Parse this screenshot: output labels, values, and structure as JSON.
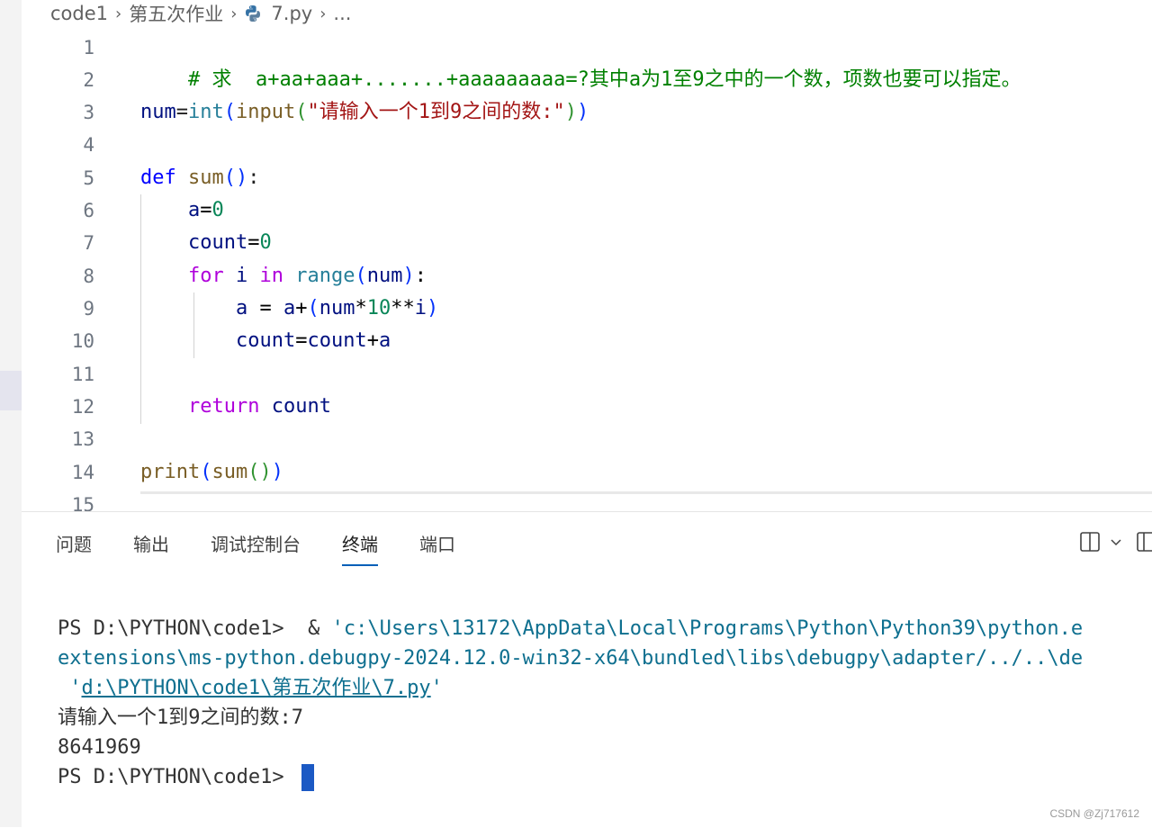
{
  "breadcrumb": {
    "root": "code1",
    "folder": "第五次作业",
    "file": "7.py",
    "more": "..."
  },
  "code_lines": [
    {
      "n": "1"
    },
    {
      "n": "2"
    },
    {
      "n": "3"
    },
    {
      "n": "4"
    },
    {
      "n": "5"
    },
    {
      "n": "6"
    },
    {
      "n": "7"
    },
    {
      "n": "8"
    },
    {
      "n": "9"
    },
    {
      "n": "10"
    },
    {
      "n": "11"
    },
    {
      "n": "12"
    },
    {
      "n": "13"
    },
    {
      "n": "14"
    },
    {
      "n": "15"
    }
  ],
  "code": {
    "l1_comment": "# 求  a+aa+aaa+.......+aaaaaaaaa=?其中a为1至9之中的一个数，项数也要可以指定。",
    "l3_var": "num",
    "l3_eq": "=",
    "l3_int": "int",
    "l3_input": "input",
    "l3_str": "\"请输入一个1到9之间的数:\"",
    "l5_def": "def",
    "l5_fn": "sum",
    "l5_tail": ":",
    "l6_var": "a",
    "l6_num": "0",
    "l7_var": "count",
    "l7_num": "0",
    "l8_for": "for",
    "l8_i": "i",
    "l8_in": "in",
    "l8_range": "range",
    "l8_num": "num",
    "l9_a": "a",
    "l9_mid": " = ",
    "l9_a2": "a",
    "l9_num": "num",
    "l9_ten": "10",
    "l9_i": "i",
    "l10_count": "count",
    "l10_count2": "count",
    "l10_a": "a",
    "l12_return": "return",
    "l12_count": "count",
    "l14_print": "print",
    "l14_sum": "sum"
  },
  "panel": {
    "tabs": [
      {
        "label": "问题"
      },
      {
        "label": "输出"
      },
      {
        "label": "调试控制台"
      },
      {
        "label": "终端"
      },
      {
        "label": "端口"
      }
    ],
    "active_tab": "终端"
  },
  "terminal": {
    "line1": "PS D:\\PYTHON\\code1>  & 'c:\\Users\\13172\\AppData\\Local\\Programs\\Python\\Python39\\python.e",
    "line2": "extensions\\ms-python.debugpy-2024.12.0-win32-x64\\bundled\\libs\\debugpy\\adapter/../..\\de",
    "line3_pre": " '",
    "line3_link": "d:\\PYTHON\\code1\\第五次作业\\7.py",
    "line3_post": "'",
    "line4": "请输入一个1到9之间的数:7",
    "line5": "8641969",
    "line6": "PS D:\\PYTHON\\code1> "
  },
  "watermark": "CSDN @Zj717612",
  "colors": {
    "comment": "#008000",
    "keyword": "#0000ff",
    "control": "#af00db",
    "function": "#795e26",
    "builtin": "#267f99",
    "variable": "#001080",
    "string": "#a31515",
    "number": "#098658",
    "accent": "#005fb8",
    "cursor": "#1b59c4"
  },
  "icons": {
    "python_file": "python-file-icon",
    "chevron": "chevron-right-icon",
    "split": "split-terminal-icon",
    "dropdown": "chevron-down-icon",
    "layout": "panel-layout-icon"
  }
}
